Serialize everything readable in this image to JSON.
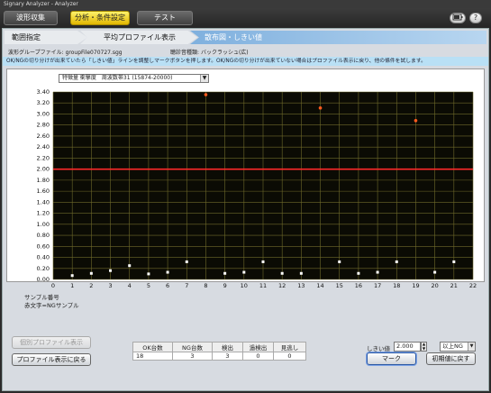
{
  "window": {
    "title": "Signary Analyzer - Analyzer"
  },
  "top_tabs": [
    {
      "label": "波形収集",
      "active": false
    },
    {
      "label": "分析・条件設定",
      "active": true
    },
    {
      "label": "テスト",
      "active": false
    }
  ],
  "top_icons": {
    "battery": "battery-icon",
    "help": "?"
  },
  "steps": [
    {
      "label": "範囲指定",
      "state": "done"
    },
    {
      "label": "平均プロファイル表示",
      "state": "done"
    },
    {
      "label": "散布図・しきい値",
      "state": "current"
    }
  ],
  "file_info": {
    "label": "波形グループファイル:",
    "value": "groupFile070727.sgg",
    "sound_label": "聴診音種類:",
    "sound_value": "バックラッシュ(広)"
  },
  "instruction": "OK/NGの切り分けが出来ていたら「しきい値」ラインを調整しマークボタンを押します。OK/NGの切り分けが出来ていない場合はプロファイル表示に戻り、他の條件を試します。",
  "feature_select": "特徴量 衝撃度　周波数帯31 (15874-20000)",
  "chart_data": {
    "type": "scatter",
    "xlim": [
      0,
      22
    ],
    "ylim": [
      0,
      3.4
    ],
    "x_ticks": [
      0,
      1,
      2,
      3,
      4,
      5,
      6,
      7,
      8,
      9,
      10,
      11,
      12,
      13,
      14,
      15,
      16,
      17,
      18,
      19,
      20,
      21,
      22
    ],
    "y_ticks": [
      "0.00",
      "0.20",
      "0.40",
      "0.60",
      "0.80",
      "1.00",
      "1.20",
      "1.40",
      "1.60",
      "1.80",
      "2.00",
      "2.20",
      "2.40",
      "2.60",
      "2.80",
      "3.00",
      "3.20",
      "3.40"
    ],
    "grid": true,
    "threshold": 2.0,
    "ok_points": [
      {
        "x": 1,
        "y": 0.07
      },
      {
        "x": 2,
        "y": 0.11
      },
      {
        "x": 3,
        "y": 0.16
      },
      {
        "x": 4,
        "y": 0.25
      },
      {
        "x": 5,
        "y": 0.1
      },
      {
        "x": 6,
        "y": 0.13
      },
      {
        "x": 7,
        "y": 0.32
      },
      {
        "x": 9,
        "y": 0.11
      },
      {
        "x": 10,
        "y": 0.13
      },
      {
        "x": 11,
        "y": 0.32
      },
      {
        "x": 12,
        "y": 0.11
      },
      {
        "x": 13,
        "y": 0.11
      },
      {
        "x": 15,
        "y": 0.32
      },
      {
        "x": 16,
        "y": 0.11
      },
      {
        "x": 17,
        "y": 0.13
      },
      {
        "x": 18,
        "y": 0.32
      },
      {
        "x": 20,
        "y": 0.13
      },
      {
        "x": 21,
        "y": 0.32
      }
    ],
    "ng_points": [
      {
        "x": 8,
        "y": 3.35
      },
      {
        "x": 14,
        "y": 3.11
      },
      {
        "x": 19,
        "y": 2.88
      }
    ],
    "colors": {
      "background": "#0b0b04",
      "grid": "#6f6a2a",
      "ok": "#ffffff",
      "ng": "#ff5a1e",
      "threshold": "#ff2a2a",
      "axis_text": "#111111"
    }
  },
  "sample_label_1": "サンプル番号",
  "sample_label_2": "赤文字=NGサンプル",
  "summary": {
    "headers": [
      "OK台数",
      "NG台数",
      "検出",
      "過検出",
      "見逃し"
    ],
    "values": [
      "18",
      "3",
      "3",
      "0",
      "0"
    ]
  },
  "threshold": {
    "label": "しきい値",
    "value": "2.000",
    "mode": "以上NG"
  },
  "buttons": {
    "profile_disabled": "個別プロファイル表示",
    "back_to_profile": "プロファイル表示に戻る",
    "mark": "マーク",
    "reset": "初期値に戻す"
  }
}
